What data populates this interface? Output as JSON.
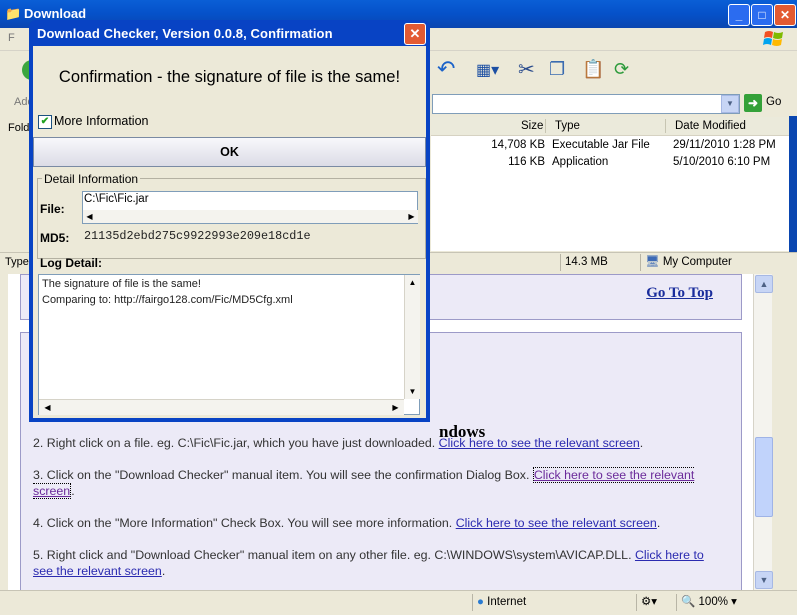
{
  "explorer": {
    "title": "Download",
    "menu_fragment": "F",
    "address_label_fragment": "Add",
    "folders_label_fragment": "Folde",
    "go_label": "Go",
    "columns": {
      "size": "Size",
      "type": "Type",
      "date_modified": "Date Modified"
    },
    "files": [
      {
        "size": "14,708 KB",
        "type": "Executable Jar File",
        "date": "29/11/2010 1:28 PM"
      },
      {
        "size": "116 KB",
        "type": "Application",
        "date": "5/10/2010 6:10 PM"
      }
    ],
    "status": {
      "type_fragment": "Type:",
      "size": "14.3 MB",
      "location": "My Computer"
    }
  },
  "dialog": {
    "title": "Download Checker, Version 0.0.8, Confirmation",
    "message": "Confirmation - the signature of file is the same!",
    "more_info_label": "More Information",
    "more_info_checked": true,
    "ok_label": "OK",
    "detail_legend": "Detail Information",
    "file_label": "File:",
    "file_value": "C:\\Fic\\Fic.jar",
    "md5_label": "MD5:",
    "md5_value": "21135d2ebd275c9922993e209e18cd1e",
    "log_label": "Log Detail:",
    "log_lines": [
      "The signature of file is the same!",
      "Comparing to: http://fairgo128.com/Fic/MD5Cfg.xml"
    ]
  },
  "web": {
    "go_to_top": "Go To Top",
    "heading_fragment": "ndows",
    "steps": [
      {
        "text": "2. Right click on a file. eg. C:\\Fic\\Fic.jar, which you have just downloaded. ",
        "link": "Click here to see the relevant screen",
        "after": "."
      },
      {
        "text": "3. Click on the \"Download Checker\" manual item. You will see the confirmation Dialog Box. ",
        "link": "Click here to see the relevant screen",
        "after": "."
      },
      {
        "text": "4. Click on the \"More Information\" Check Box. You will see more information. ",
        "link": "Click here to see the relevant screen",
        "after": "."
      },
      {
        "text": "5. Right click and \"Download Checker\" manual item on any other file. eg. C:\\WINDOWS\\system\\AVICAP.DLL. ",
        "link": "Click here to see the relevant screen",
        "after": "."
      }
    ]
  },
  "browser_status": {
    "zone": "Internet",
    "zoom": "100%"
  },
  "colors": {
    "xp_title_blue": "#0843c4",
    "link": "#2b2bb0",
    "visited_link": "#6b2b9a",
    "close_red": "#e35a32"
  }
}
